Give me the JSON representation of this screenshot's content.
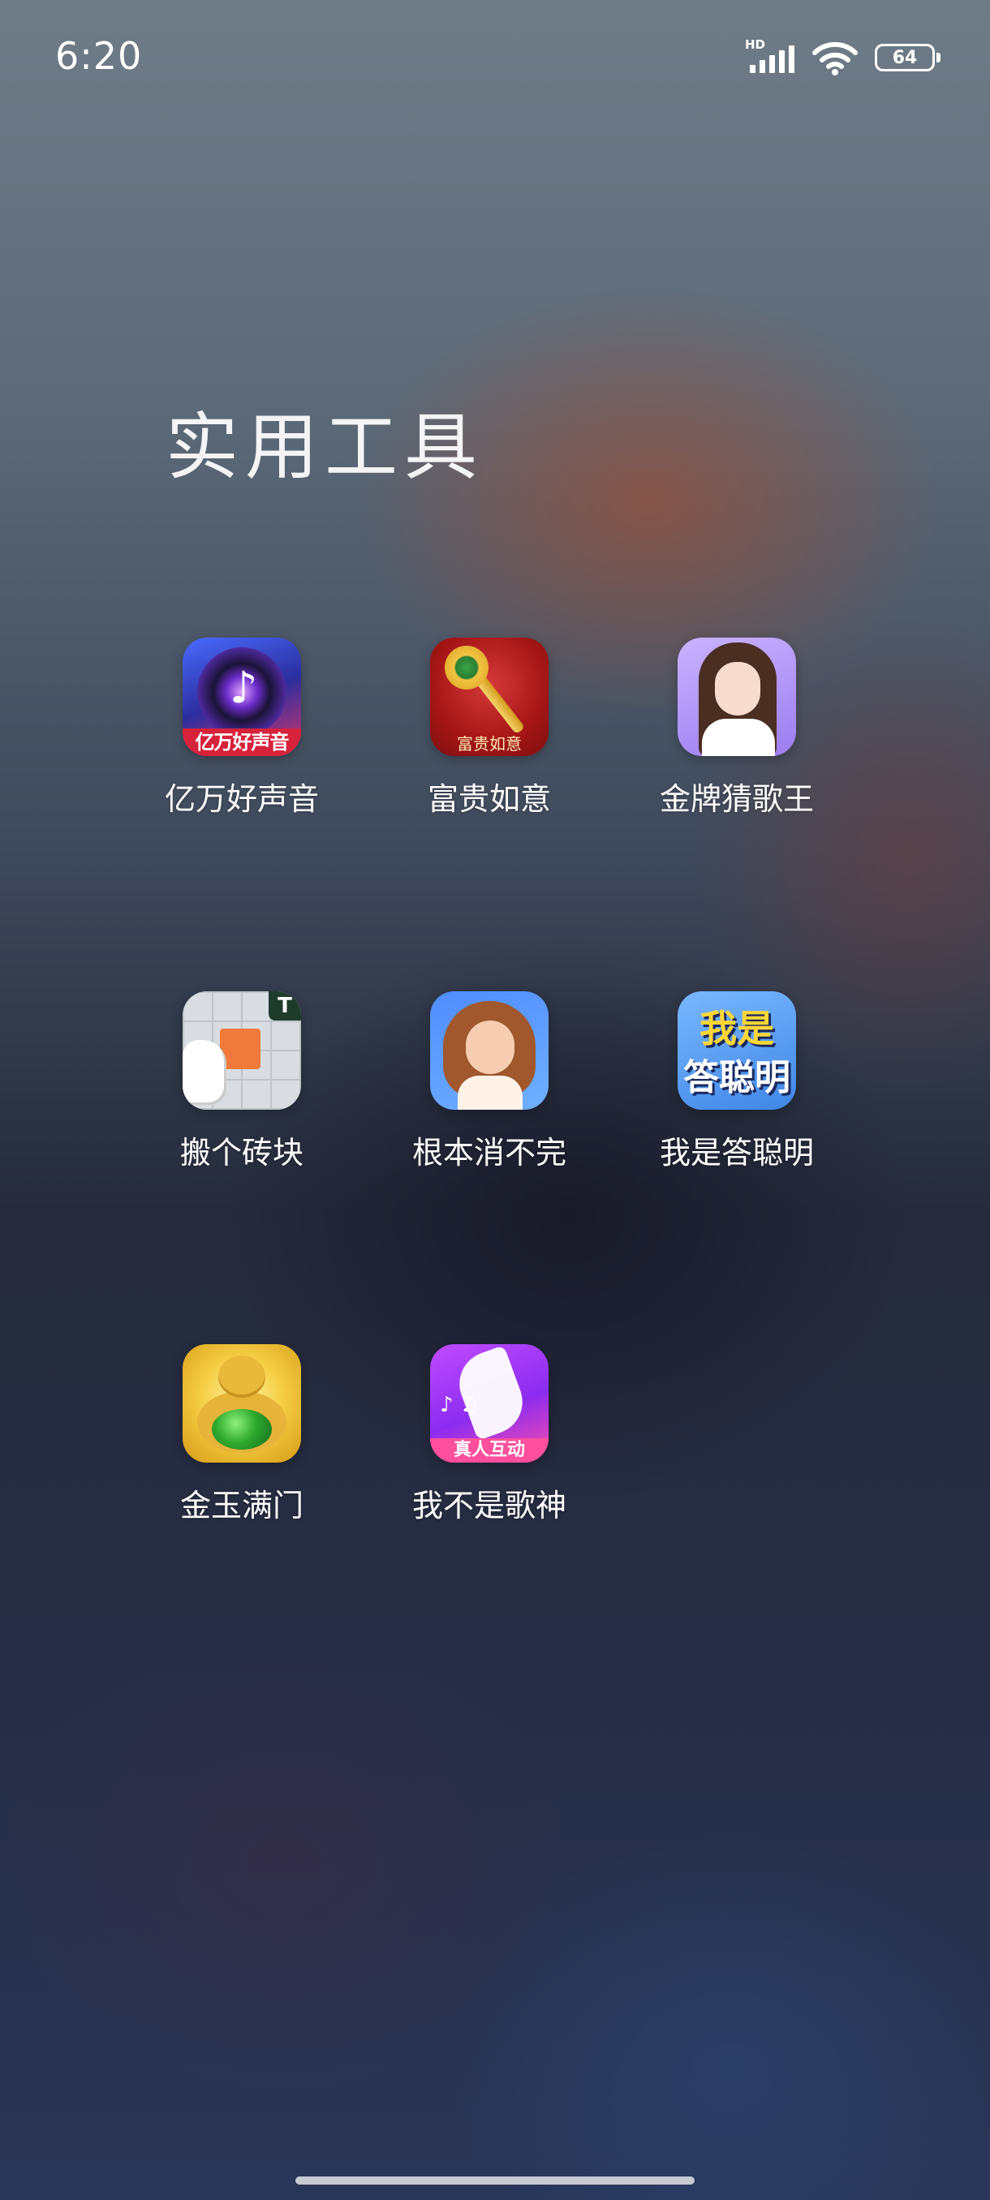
{
  "status_bar": {
    "time": "6:20",
    "network": "HD",
    "battery": "64",
    "icons": [
      "signal-icon",
      "wifi-icon",
      "battery-icon"
    ]
  },
  "folder": {
    "title": "实用工具",
    "apps": [
      {
        "label": "亿万好声音",
        "icon": "music-disc-app-icon",
        "icon_text": "亿万好声音"
      },
      {
        "label": "富贵如意",
        "icon": "ruyi-scepter-app-icon",
        "icon_text": "富贵如意"
      },
      {
        "label": "金牌猜歌王",
        "icon": "singer-girl-app-icon"
      },
      {
        "label": "搬个砖块",
        "icon": "brick-puzzle-app-icon",
        "icon_text": "T"
      },
      {
        "label": "根本消不完",
        "icon": "cartoon-girl-app-icon"
      },
      {
        "label": "我是答聪明",
        "icon": "quiz-app-icon",
        "icon_text_1": "我是",
        "icon_text_2": "答聪明"
      },
      {
        "label": "金玉满门",
        "icon": "golden-buddha-app-icon"
      },
      {
        "label": "我不是歌神",
        "icon": "dancer-app-icon",
        "icon_text": "真人互动"
      }
    ]
  }
}
